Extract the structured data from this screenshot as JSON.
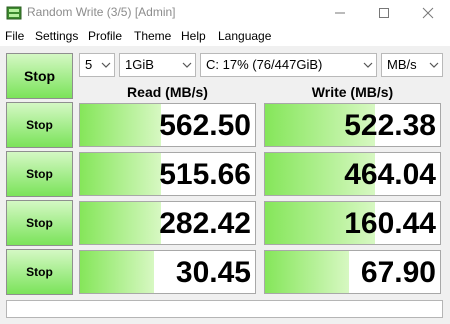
{
  "window": {
    "title": "Random Write (3/5) [Admin]",
    "minimize_icon": "minimize-icon",
    "maximize_icon": "maximize-icon",
    "close_icon": "close-icon"
  },
  "menu": [
    "File",
    "Settings",
    "Profile",
    "Theme",
    "Help",
    "Language"
  ],
  "controls": {
    "all_button": "Stop",
    "count": "5",
    "size": "1GiB",
    "drive": "C: 17% (76/447GiB)",
    "unit": "MB/s"
  },
  "headers": {
    "read": "Read (MB/s)",
    "write": "Write (MB/s)"
  },
  "rows": [
    {
      "button": "Stop",
      "read": "562.50",
      "write": "522.38",
      "read_fill": 0.46,
      "write_fill": 0.63
    },
    {
      "button": "Stop",
      "read": "515.66",
      "write": "464.04",
      "read_fill": 0.46,
      "write_fill": 0.63
    },
    {
      "button": "Stop",
      "read": "282.42",
      "write": "160.44",
      "read_fill": 0.46,
      "write_fill": 0.63
    },
    {
      "button": "Stop",
      "read": "30.45",
      "write": "67.90",
      "read_fill": 0.42,
      "write_fill": 0.48
    }
  ],
  "colors": {
    "accent_green": "#7be35a",
    "bar_green": "#85e65a"
  }
}
